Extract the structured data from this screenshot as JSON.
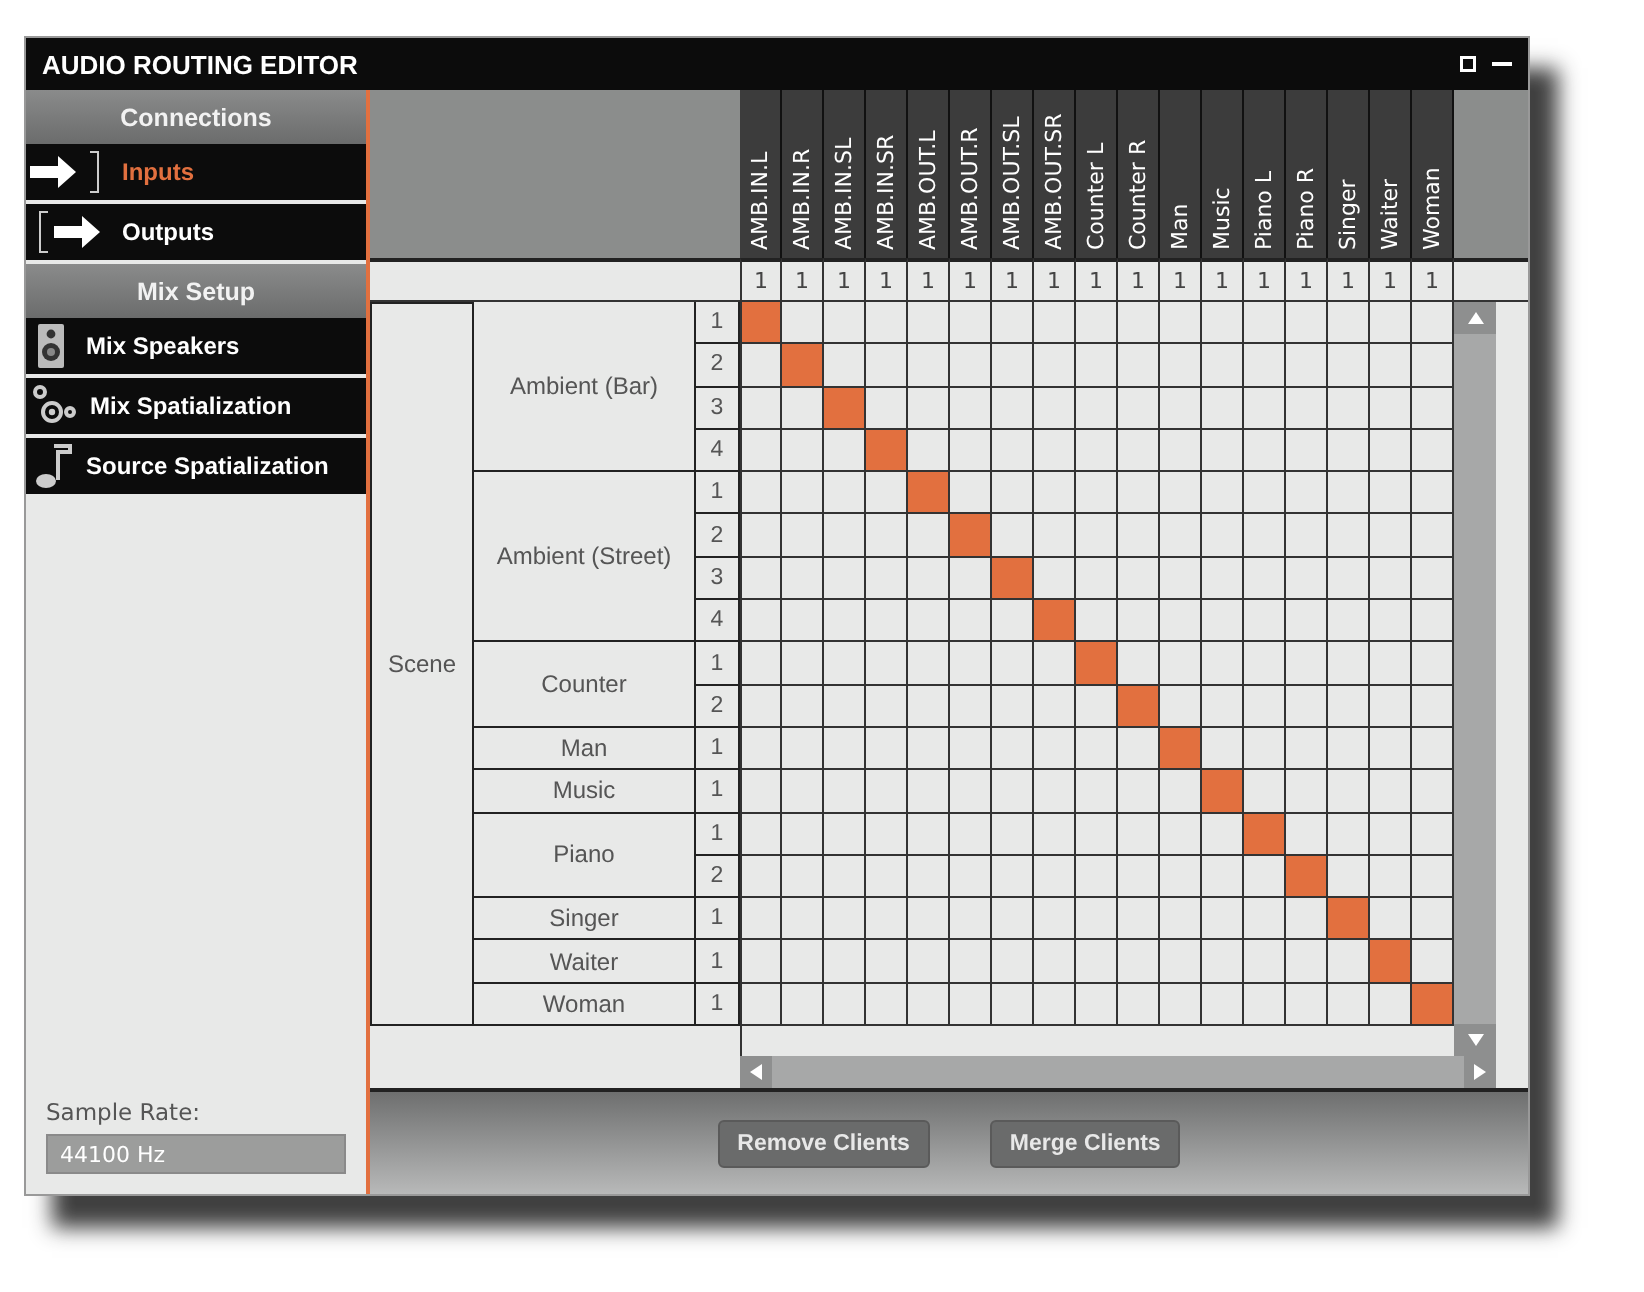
{
  "window": {
    "title": "AUDIO ROUTING EDITOR"
  },
  "sidebar": {
    "sections": [
      {
        "title": "Connections",
        "items": [
          {
            "label": "Inputs",
            "kind": "input",
            "selected": true
          },
          {
            "label": "Outputs",
            "kind": "output",
            "selected": false
          }
        ]
      },
      {
        "title": "Mix Setup",
        "items": [
          {
            "label": "Mix Speakers",
            "kind": "speaker",
            "selected": false
          },
          {
            "label": "Mix Spatialization",
            "kind": "gears",
            "selected": false
          },
          {
            "label": "Source Spatialization",
            "kind": "note",
            "selected": false
          }
        ]
      }
    ],
    "sample_rate": {
      "label": "Sample Rate:",
      "value": "44100 Hz"
    }
  },
  "matrix": {
    "columns": [
      {
        "label": "AMB.IN.L",
        "count": "1"
      },
      {
        "label": "AMB.IN.R",
        "count": "1"
      },
      {
        "label": "AMB.IN.SL",
        "count": "1"
      },
      {
        "label": "AMB.IN.SR",
        "count": "1"
      },
      {
        "label": "AMB.OUT.L",
        "count": "1"
      },
      {
        "label": "AMB.OUT.R",
        "count": "1"
      },
      {
        "label": "AMB.OUT.SL",
        "count": "1"
      },
      {
        "label": "AMB.OUT.SR",
        "count": "1"
      },
      {
        "label": "Counter L",
        "count": "1"
      },
      {
        "label": "Counter R",
        "count": "1"
      },
      {
        "label": "Man",
        "count": "1"
      },
      {
        "label": "Music",
        "count": "1"
      },
      {
        "label": "Piano L",
        "count": "1"
      },
      {
        "label": "Piano R",
        "count": "1"
      },
      {
        "label": "Singer",
        "count": "1"
      },
      {
        "label": "Waiter",
        "count": "1"
      },
      {
        "label": "Woman",
        "count": "1"
      }
    ],
    "groups": [
      {
        "label": "Scene",
        "clients": [
          {
            "label": "Ambient (Bar)",
            "channels": [
              {
                "label": "1",
                "routes": [
                  true,
                  false,
                  false,
                  false,
                  false,
                  false,
                  false,
                  false,
                  false,
                  false,
                  false,
                  false,
                  false,
                  false,
                  false,
                  false,
                  false
                ]
              },
              {
                "label": "2",
                "routes": [
                  false,
                  true,
                  false,
                  false,
                  false,
                  false,
                  false,
                  false,
                  false,
                  false,
                  false,
                  false,
                  false,
                  false,
                  false,
                  false,
                  false
                ]
              },
              {
                "label": "3",
                "routes": [
                  false,
                  false,
                  true,
                  false,
                  false,
                  false,
                  false,
                  false,
                  false,
                  false,
                  false,
                  false,
                  false,
                  false,
                  false,
                  false,
                  false
                ]
              },
              {
                "label": "4",
                "routes": [
                  false,
                  false,
                  false,
                  true,
                  false,
                  false,
                  false,
                  false,
                  false,
                  false,
                  false,
                  false,
                  false,
                  false,
                  false,
                  false,
                  false
                ]
              }
            ]
          },
          {
            "label": "Ambient (Street)",
            "channels": [
              {
                "label": "1",
                "routes": [
                  false,
                  false,
                  false,
                  false,
                  true,
                  false,
                  false,
                  false,
                  false,
                  false,
                  false,
                  false,
                  false,
                  false,
                  false,
                  false,
                  false
                ]
              },
              {
                "label": "2",
                "routes": [
                  false,
                  false,
                  false,
                  false,
                  false,
                  true,
                  false,
                  false,
                  false,
                  false,
                  false,
                  false,
                  false,
                  false,
                  false,
                  false,
                  false
                ]
              },
              {
                "label": "3",
                "routes": [
                  false,
                  false,
                  false,
                  false,
                  false,
                  false,
                  true,
                  false,
                  false,
                  false,
                  false,
                  false,
                  false,
                  false,
                  false,
                  false,
                  false
                ]
              },
              {
                "label": "4",
                "routes": [
                  false,
                  false,
                  false,
                  false,
                  false,
                  false,
                  false,
                  true,
                  false,
                  false,
                  false,
                  false,
                  false,
                  false,
                  false,
                  false,
                  false
                ]
              }
            ]
          },
          {
            "label": "Counter",
            "channels": [
              {
                "label": "1",
                "routes": [
                  false,
                  false,
                  false,
                  false,
                  false,
                  false,
                  false,
                  false,
                  true,
                  false,
                  false,
                  false,
                  false,
                  false,
                  false,
                  false,
                  false
                ]
              },
              {
                "label": "2",
                "routes": [
                  false,
                  false,
                  false,
                  false,
                  false,
                  false,
                  false,
                  false,
                  false,
                  true,
                  false,
                  false,
                  false,
                  false,
                  false,
                  false,
                  false
                ]
              }
            ]
          },
          {
            "label": "Man",
            "channels": [
              {
                "label": "1",
                "routes": [
                  false,
                  false,
                  false,
                  false,
                  false,
                  false,
                  false,
                  false,
                  false,
                  false,
                  true,
                  false,
                  false,
                  false,
                  false,
                  false,
                  false
                ]
              }
            ]
          },
          {
            "label": "Music",
            "channels": [
              {
                "label": "1",
                "routes": [
                  false,
                  false,
                  false,
                  false,
                  false,
                  false,
                  false,
                  false,
                  false,
                  false,
                  false,
                  true,
                  false,
                  false,
                  false,
                  false,
                  false
                ]
              }
            ]
          },
          {
            "label": "Piano",
            "channels": [
              {
                "label": "1",
                "routes": [
                  false,
                  false,
                  false,
                  false,
                  false,
                  false,
                  false,
                  false,
                  false,
                  false,
                  false,
                  false,
                  true,
                  false,
                  false,
                  false,
                  false
                ]
              },
              {
                "label": "2",
                "routes": [
                  false,
                  false,
                  false,
                  false,
                  false,
                  false,
                  false,
                  false,
                  false,
                  false,
                  false,
                  false,
                  false,
                  true,
                  false,
                  false,
                  false
                ]
              }
            ]
          },
          {
            "label": "Singer",
            "channels": [
              {
                "label": "1",
                "routes": [
                  false,
                  false,
                  false,
                  false,
                  false,
                  false,
                  false,
                  false,
                  false,
                  false,
                  false,
                  false,
                  false,
                  false,
                  true,
                  false,
                  false
                ]
              }
            ]
          },
          {
            "label": "Waiter",
            "channels": [
              {
                "label": "1",
                "routes": [
                  false,
                  false,
                  false,
                  false,
                  false,
                  false,
                  false,
                  false,
                  false,
                  false,
                  false,
                  false,
                  false,
                  false,
                  false,
                  true,
                  false
                ]
              }
            ]
          },
          {
            "label": "Woman",
            "channels": [
              {
                "label": "1",
                "routes": [
                  false,
                  false,
                  false,
                  false,
                  false,
                  false,
                  false,
                  false,
                  false,
                  false,
                  false,
                  false,
                  false,
                  false,
                  false,
                  false,
                  true
                ]
              }
            ]
          }
        ]
      }
    ]
  },
  "buttons": [
    "Remove Clients",
    "Merge Clients"
  ]
}
